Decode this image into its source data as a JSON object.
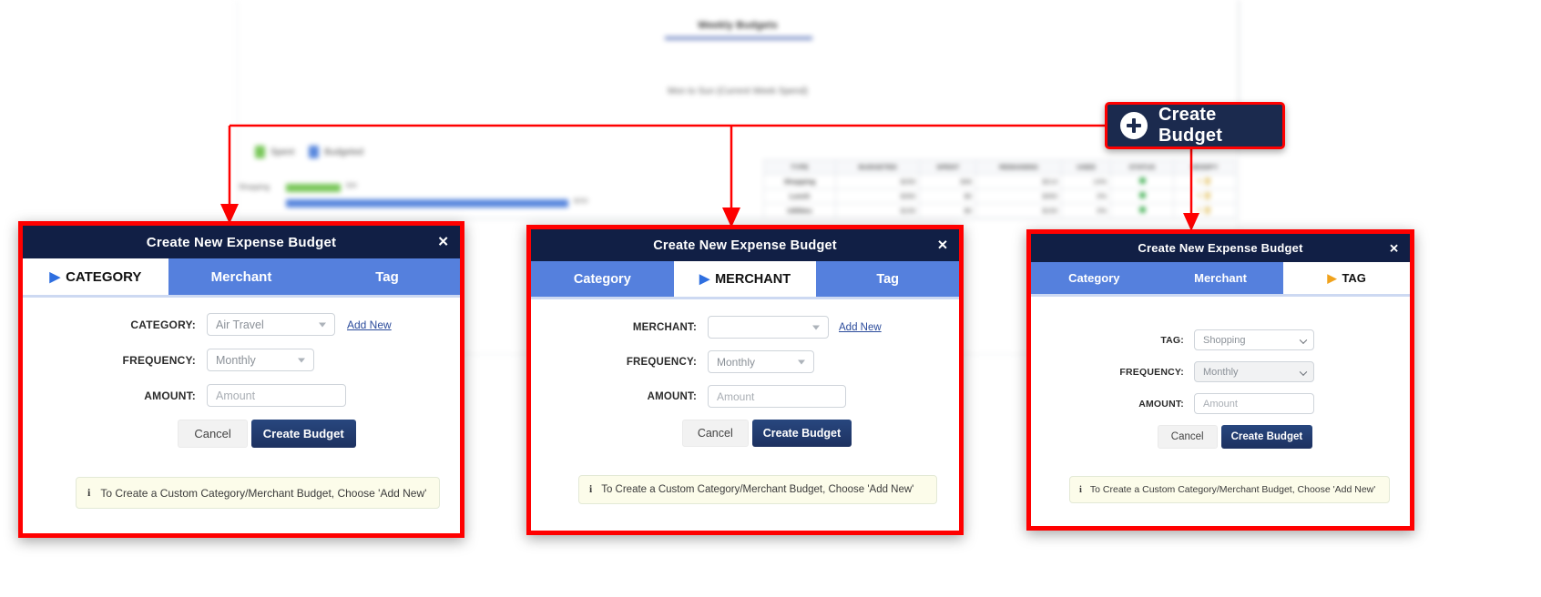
{
  "background": {
    "chart_title": "Weekly Budgets",
    "chart_subtitle": "Mon to Sun (Current Week Spend)",
    "legend": [
      {
        "label": "Spent",
        "color": "#6cc24a"
      },
      {
        "label": "Budgeted",
        "color": "#4a7ddb"
      }
    ],
    "bars": [
      {
        "category": "Shopping",
        "spent_label": "$36",
        "budget_label": "$250",
        "spent_pct": 14,
        "budget_pct": 100
      }
    ],
    "table": {
      "headers": [
        "TYPE",
        "BUDGETED",
        "SPENT",
        "REMAINING",
        "USED",
        "STATUS",
        "MODIFY"
      ],
      "rows": [
        {
          "type": "Shopping",
          "budgeted": "$250",
          "spent": "$36",
          "remaining": "$214",
          "used": "14%",
          "status": "ok",
          "modify": "edit-delete"
        },
        {
          "type": "Lunch",
          "budgeted": "$350",
          "spent": "$0",
          "remaining": "$350",
          "used": "0%",
          "status": "ok",
          "modify": "edit-delete"
        },
        {
          "type": "Utilities",
          "budgeted": "$150",
          "spent": "$0",
          "remaining": "$150",
          "used": "0%",
          "status": "ok",
          "modify": "edit-delete"
        }
      ]
    }
  },
  "create_budget_button": {
    "label": "Create Budget",
    "icon": "plus-circle-icon",
    "background_color": "#1b2a4e"
  },
  "dialogs": [
    {
      "id": "category",
      "title": "Create New Expense Budget",
      "close_label": "✕",
      "tabs": [
        {
          "label": "CATEGORY",
          "active": true,
          "arrow": "▶",
          "arrow_color": "#2f6fe0"
        },
        {
          "label": "Merchant",
          "active": false,
          "arrow": "",
          "arrow_color": ""
        },
        {
          "label": "Tag",
          "active": false,
          "arrow": "",
          "arrow_color": ""
        }
      ],
      "fields": [
        {
          "label": "CATEGORY:",
          "value": "Air Travel",
          "placeholder": "",
          "control": "dropdown",
          "style": "white",
          "link": "Add New"
        },
        {
          "label": "FREQUENCY:",
          "value": "Monthly",
          "placeholder": "",
          "control": "dropdown",
          "style": "white",
          "link": ""
        },
        {
          "label": "AMOUNT:",
          "value": "",
          "placeholder": "Amount",
          "control": "text",
          "style": "white",
          "link": ""
        }
      ],
      "buttons": {
        "cancel": "Cancel",
        "submit": "Create Budget"
      },
      "info": {
        "icon": "info-icon",
        "text": "To Create a Custom Category/Merchant Budget, Choose 'Add New'"
      }
    },
    {
      "id": "merchant",
      "title": "Create New Expense Budget",
      "close_label": "✕",
      "tabs": [
        {
          "label": "Category",
          "active": false,
          "arrow": "",
          "arrow_color": ""
        },
        {
          "label": "MERCHANT",
          "active": true,
          "arrow": "▶",
          "arrow_color": "#2f6fe0"
        },
        {
          "label": "Tag",
          "active": false,
          "arrow": "",
          "arrow_color": ""
        }
      ],
      "fields": [
        {
          "label": "MERCHANT:",
          "value": "",
          "placeholder": "",
          "control": "dropdown",
          "style": "white",
          "link": "Add New"
        },
        {
          "label": "FREQUENCY:",
          "value": "Monthly",
          "placeholder": "",
          "control": "dropdown",
          "style": "white",
          "link": ""
        },
        {
          "label": "AMOUNT:",
          "value": "",
          "placeholder": "Amount",
          "control": "text",
          "style": "white",
          "link": ""
        }
      ],
      "buttons": {
        "cancel": "Cancel",
        "submit": "Create Budget"
      },
      "info": {
        "icon": "info-icon",
        "text": "To Create a Custom Category/Merchant Budget, Choose 'Add New'"
      }
    },
    {
      "id": "tag",
      "title": "Create New Expense Budget",
      "close_label": "✕",
      "tabs": [
        {
          "label": "Category",
          "active": false,
          "arrow": "",
          "arrow_color": ""
        },
        {
          "label": "Merchant",
          "active": false,
          "arrow": "",
          "arrow_color": ""
        },
        {
          "label": "TAG",
          "active": true,
          "arrow": "▶",
          "arrow_color": "#f0a21c"
        }
      ],
      "fields": [
        {
          "label": "TAG:",
          "value": "Shopping",
          "placeholder": "",
          "control": "select",
          "style": "white",
          "link": ""
        },
        {
          "label": "FREQUENCY:",
          "value": "Monthly",
          "placeholder": "",
          "control": "select",
          "style": "grayed",
          "link": ""
        },
        {
          "label": "AMOUNT:",
          "value": "",
          "placeholder": "Amount",
          "control": "text",
          "style": "white",
          "link": ""
        }
      ],
      "buttons": {
        "cancel": "Cancel",
        "submit": "Create Budget"
      },
      "info": {
        "icon": "info-icon",
        "text": "To Create a Custom Category/Merchant Budget, Choose 'Add New'"
      }
    }
  ]
}
